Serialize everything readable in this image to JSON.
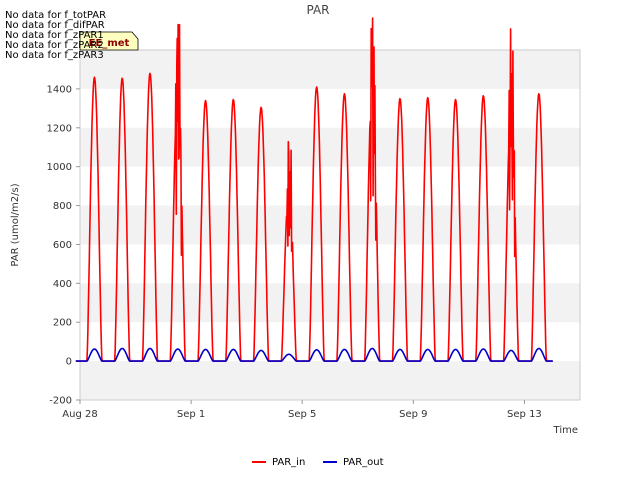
{
  "chart_data": {
    "type": "line",
    "title": "PAR",
    "xlabel": "Time",
    "ylabel": "PAR (umol/m2/s)",
    "ylim": [
      -200,
      1600
    ],
    "yticks": [
      -200,
      0,
      200,
      400,
      600,
      800,
      1000,
      1200,
      1400
    ],
    "xlim": [
      "2023-08-28",
      "2023-09-15 00:00"
    ],
    "xticks": [
      {
        "date": "2023-08-28",
        "label": "Aug 28"
      },
      {
        "date": "2023-09-01",
        "label": "Sep 1"
      },
      {
        "date": "2023-09-05",
        "label": "Sep 5"
      },
      {
        "date": "2023-09-09",
        "label": "Sep 9"
      },
      {
        "date": "2023-09-13",
        "label": "Sep 13"
      }
    ],
    "grid": "horizontal alternating bands",
    "legend_position": "bottom-center",
    "series": [
      {
        "name": "PAR_in",
        "color": "#ff0000",
        "daily_peaks": [
          {
            "date": "2023-08-28",
            "peak": 1460
          },
          {
            "date": "2023-08-29",
            "peak": 1455
          },
          {
            "date": "2023-08-30",
            "peak": 1480
          },
          {
            "date": "2023-08-31",
            "peak": 1405
          },
          {
            "date": "2023-09-01",
            "peak": 1340
          },
          {
            "date": "2023-09-02",
            "peak": 1345
          },
          {
            "date": "2023-09-03",
            "peak": 1305
          },
          {
            "date": "2023-09-04",
            "peak": 890
          },
          {
            "date": "2023-09-05",
            "peak": 1410
          },
          {
            "date": "2023-09-06",
            "peak": 1375
          },
          {
            "date": "2023-09-07",
            "peak": 1430
          },
          {
            "date": "2023-09-08",
            "peak": 1350
          },
          {
            "date": "2023-09-09",
            "peak": 1355
          },
          {
            "date": "2023-09-10",
            "peak": 1345
          },
          {
            "date": "2023-09-11",
            "peak": 1365
          },
          {
            "date": "2023-09-12",
            "peak": 1300
          },
          {
            "date": "2023-09-13",
            "peak": 1375
          }
        ]
      },
      {
        "name": "PAR_out",
        "color": "#0000cc",
        "daily_peaks": [
          {
            "date": "2023-08-28",
            "peak": 62
          },
          {
            "date": "2023-08-29",
            "peak": 65
          },
          {
            "date": "2023-08-30",
            "peak": 65
          },
          {
            "date": "2023-08-31",
            "peak": 62
          },
          {
            "date": "2023-09-01",
            "peak": 60
          },
          {
            "date": "2023-09-02",
            "peak": 60
          },
          {
            "date": "2023-09-03",
            "peak": 55
          },
          {
            "date": "2023-09-04",
            "peak": 35
          },
          {
            "date": "2023-09-05",
            "peak": 58
          },
          {
            "date": "2023-09-06",
            "peak": 60
          },
          {
            "date": "2023-09-07",
            "peak": 65
          },
          {
            "date": "2023-09-08",
            "peak": 60
          },
          {
            "date": "2023-09-09",
            "peak": 60
          },
          {
            "date": "2023-09-10",
            "peak": 60
          },
          {
            "date": "2023-09-11",
            "peak": 62
          },
          {
            "date": "2023-09-12",
            "peak": 55
          },
          {
            "date": "2023-09-13",
            "peak": 65
          }
        ]
      }
    ]
  },
  "no_data_messages": [
    "No data for f_totPAR",
    "No data for f_difPAR",
    "No data for f_zPAR1",
    "No data for f_zPAR2",
    "No data for f_zPAR3"
  ],
  "badge": {
    "label": "EE_met",
    "bg_color": "#ffffc0",
    "text_color": "#8b0000"
  },
  "colors": {
    "band": "#f2f2f2",
    "axis": "#cccccc"
  }
}
